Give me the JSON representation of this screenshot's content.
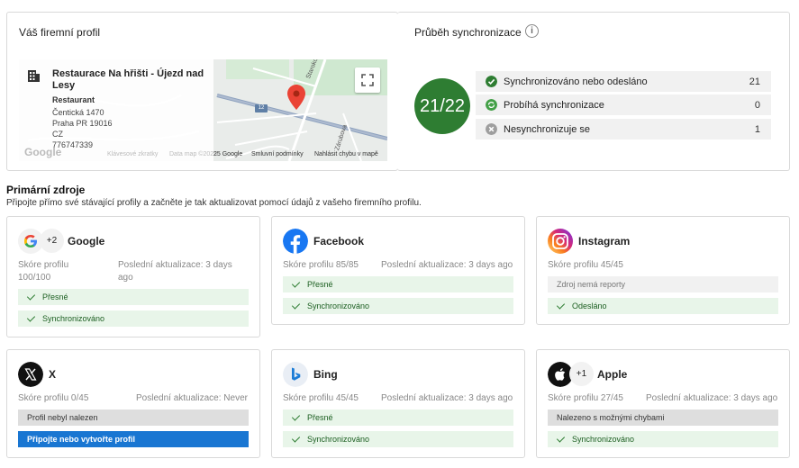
{
  "profile": {
    "title": "Váš firemní profil",
    "business_name": "Restaurace Na hřišti - Újezd nad Lesy",
    "category": "Restaurant",
    "street": "Čentická 1470",
    "city": "Praha PR 19016",
    "country": "CZ",
    "phone": "776747339",
    "map": {
      "google_watermark": "Google",
      "keyboard_shortcuts": "Klávesové zkratky",
      "map_data": "Data map ©2025",
      "scale": "25 Google",
      "terms": "Smluvní podmínky",
      "report": "Nahlásit chybu v mapě",
      "road_label": "Starokolínská",
      "road_label_2": "Zárubova",
      "route_number": "12"
    }
  },
  "sync": {
    "title": "Průběh synchronizace",
    "info_icon": "info-icon",
    "summary": "21/22",
    "accent_color": "#2e7d32",
    "rows": [
      {
        "label": "Synchronizováno nebo odesláno",
        "count": "21",
        "icon": "check-circle-icon",
        "color": "#2e7d32"
      },
      {
        "label": "Probíhá synchronizace",
        "count": "0",
        "icon": "sync-icon",
        "color": "#43a047"
      },
      {
        "label": "Nesynchronizuje se",
        "count": "1",
        "icon": "x-circle-icon",
        "color": "#9e9e9e"
      }
    ]
  },
  "primary": {
    "title": "Primární zdroje",
    "subtitle": "Připojte přímo své stávající profily a začněte je tak aktualizovat pomocí údajů z vašeho firemního profilu."
  },
  "cards": [
    {
      "name": "Google",
      "plus": "+2",
      "score": "Skóre profilu 100/100",
      "updated": "Poslední aktualizace: 3 days ago",
      "statuses": [
        {
          "text": "Přesné",
          "kind": "ok"
        },
        {
          "text": "Synchronizováno",
          "kind": "ok"
        }
      ]
    },
    {
      "name": "Facebook",
      "score": "Skóre profilu 85/85",
      "updated": "Poslední aktualizace: 3 days ago",
      "statuses": [
        {
          "text": "Přesné",
          "kind": "ok"
        },
        {
          "text": "Synchronizováno",
          "kind": "ok"
        }
      ]
    },
    {
      "name": "Instagram",
      "score": "Skóre profilu 45/45",
      "statuses": [
        {
          "text": "Zdroj nemá reporty",
          "kind": "grey"
        },
        {
          "text": "Odesláno",
          "kind": "ok"
        }
      ]
    },
    {
      "name": "X",
      "score": "Skóre profilu 0/45",
      "updated": "Poslední aktualizace: Never",
      "statuses": [
        {
          "text": "Profil nebyl nalezen",
          "kind": "greydark"
        },
        {
          "text": "Připojte nebo vytvořte profil",
          "kind": "blue"
        }
      ]
    },
    {
      "name": "Bing",
      "score": "Skóre profilu 45/45",
      "updated": "Poslední aktualizace: 3 days ago",
      "statuses": [
        {
          "text": "Přesné",
          "kind": "ok"
        },
        {
          "text": "Synchronizováno",
          "kind": "ok"
        }
      ]
    },
    {
      "name": "Apple",
      "plus": "+1",
      "score": "Skóre profilu 27/45",
      "updated": "Poslední aktualizace: 3 days ago",
      "statuses": [
        {
          "text": "Nalezeno s možnými chybami",
          "kind": "greydark"
        },
        {
          "text": "Synchronizováno",
          "kind": "ok"
        }
      ]
    }
  ]
}
